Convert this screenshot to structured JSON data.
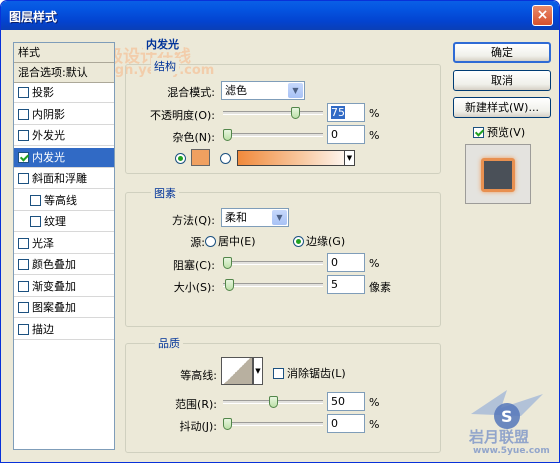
{
  "window": {
    "title": "图层样式",
    "close": "×"
  },
  "watermark": {
    "line1": "天极设计在线",
    "line2": "dign.yesky.com",
    "footer1": "岩月联盟",
    "footer2": "www.5yue.com"
  },
  "style_list": {
    "header": "样式",
    "blend_default": "混合选项:默认",
    "items": [
      {
        "label": "投影",
        "checked": false
      },
      {
        "label": "内阴影",
        "checked": false
      },
      {
        "label": "外发光",
        "checked": false
      },
      {
        "label": "内发光",
        "checked": true,
        "selected": true
      },
      {
        "label": "斜面和浮雕",
        "checked": false
      },
      {
        "label": "等高线",
        "checked": false,
        "indent": true
      },
      {
        "label": "纹理",
        "checked": false,
        "indent": true
      },
      {
        "label": "光泽",
        "checked": false
      },
      {
        "label": "颜色叠加",
        "checked": false
      },
      {
        "label": "渐变叠加",
        "checked": false
      },
      {
        "label": "图案叠加",
        "checked": false
      },
      {
        "label": "描边",
        "checked": false
      }
    ]
  },
  "inner_glow": {
    "title": "内发光",
    "structure": {
      "title": "结构",
      "blend_mode_label": "混合模式:",
      "blend_mode_value": "滤色",
      "opacity_label": "不透明度(O):",
      "opacity_value": "75",
      "opacity_unit": "%",
      "opacity_level": 0.75,
      "noise_label": "杂色(N):",
      "noise_value": "0",
      "noise_unit": "%",
      "noise_level": 0,
      "glow_color": "#f0a060"
    },
    "elements": {
      "title": "图素",
      "technique_label": "方法(Q):",
      "technique_value": "柔和",
      "source_label": "源:",
      "source_center": "居中(E)",
      "source_edge": "边缘(G)",
      "choke_label": "阻塞(C):",
      "choke_value": "0",
      "choke_unit": "%",
      "choke_level": 0,
      "size_label": "大小(S):",
      "size_value": "5",
      "size_unit": "像素",
      "size_level": 0.02
    },
    "quality": {
      "title": "品质",
      "contour_label": "等高线:",
      "antialias_label": "消除锯齿(L)",
      "range_label": "范围(R):",
      "range_value": "50",
      "range_unit": "%",
      "range_level": 0.5,
      "jitter_label": "抖动(J):",
      "jitter_value": "0",
      "jitter_unit": "%",
      "jitter_level": 0
    }
  },
  "buttons": {
    "ok": "确定",
    "cancel": "取消",
    "new_style": "新建样式(W)...",
    "preview_label": "预览(V)"
  }
}
